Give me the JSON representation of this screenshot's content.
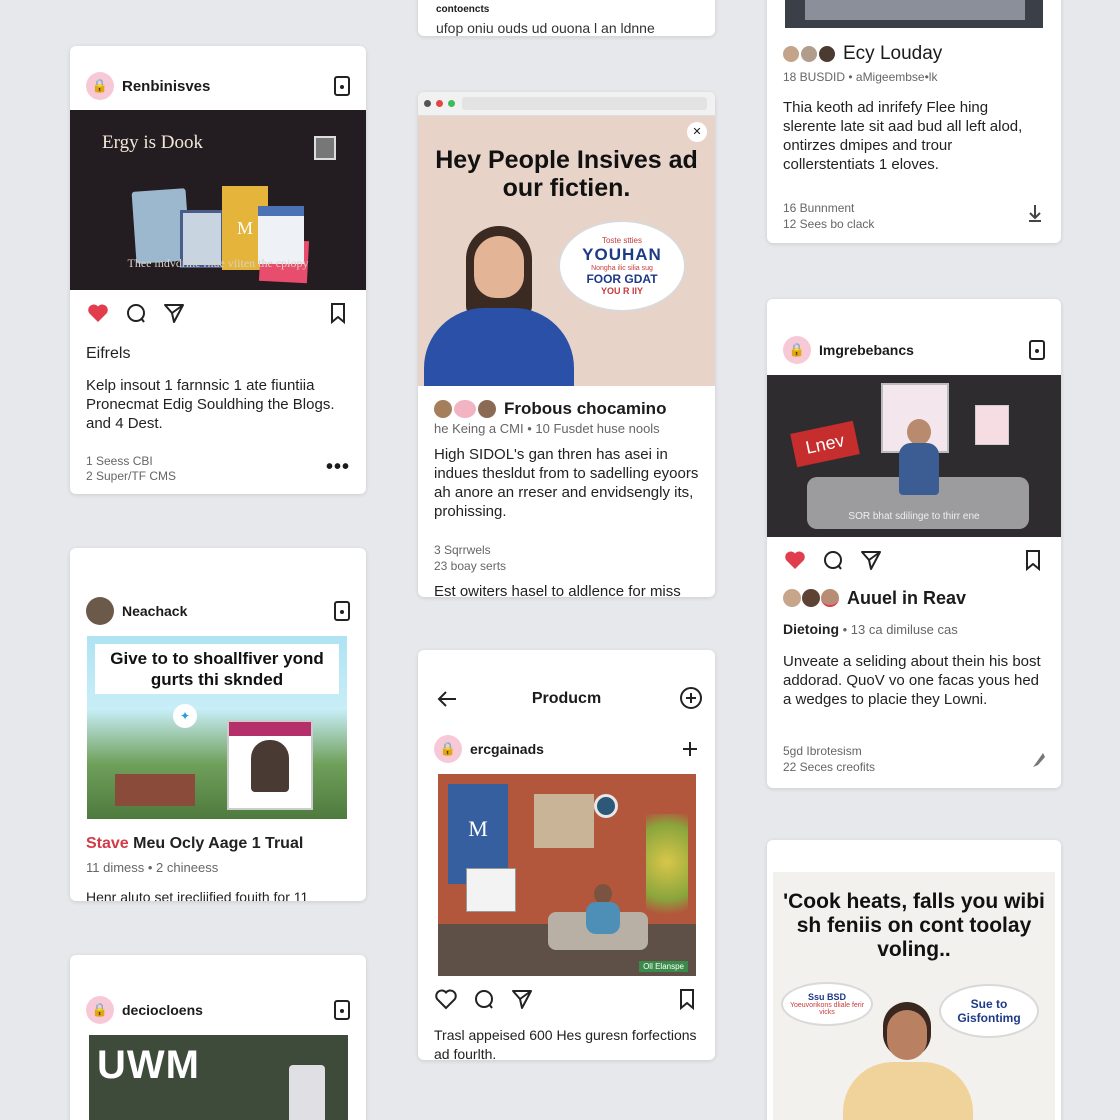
{
  "colors": {
    "like_red": "#e23d4d",
    "page_bg": "#e6e8eb",
    "accent_pink": "#f7c9d7"
  },
  "cards": {
    "top_mid": {
      "line1": "contoencts",
      "line2": "ufop oniu ouds ud ouona l an ldnne"
    },
    "c1": {
      "username": "Renbinisves",
      "image_title": "Ergy is Dook",
      "image_caption": "Thee mdvdrine rnue viiten the cpiopy",
      "book_label": "M",
      "section": "Eifrels",
      "body": "Kelp insout 1 farnnsic 1 ate fiuntiia Pronecmat Edig Souldhing the Blogs. and 4 Dest.",
      "meta1": "1 Seess CBI",
      "meta2": "2 Super/TF CMS",
      "more": "•••"
    },
    "c2": {
      "headline": "Hey People Insives ad our fictien.",
      "bubble_small": "Toste stties",
      "bubble_big": "YOUHAN",
      "bubble_mid": "Nongha ilic silia sug",
      "bubble_line": "FOOR GDAT",
      "bubble_end": "YOU R IIY",
      "username": "Frobous chocamino",
      "subline": "he Keing a CMI • 10 Fusdet huse nools",
      "body": "High SIDOL's gan thren has asei in indues thesldut from to sadelling eyoors ah anore an rreser and envidsengly its, prohissing.",
      "meta1": "3 Sqrrwels",
      "meta2": "23 boay serts",
      "footer": "Est owiters hasel to aldlence for miss"
    },
    "c3": {
      "username": "Ecy Louday",
      "subline": "18 BUSDID • aMigeembse•lk",
      "body": "Thia keoth ad inrifefy Flee hing slerente late sit aad bud all left alod, ontirzes dmipes and trour collerstentiats 1 eloves.",
      "meta1": "16 Bunnment",
      "meta2": "12 Sees bo clack"
    },
    "c4": {
      "username": "Imgrebebancs",
      "sign": "Lnev",
      "image_caption": "SOR bhat sdilinge to thirr ene",
      "names": "Auuel in Reav",
      "sub_bold": "Dietoing",
      "sub_rest": " • 13 ca dimiluse cas",
      "body": "Unveate a seliding about thein his bost addorad. QuoV vo one facas yous hed a wedges to placie they Lowni.",
      "meta1": "5gd Ibrotesism",
      "meta2": "22 Seces creofits"
    },
    "c5": {
      "username": "Neachack",
      "image_headline": "Give to to shoallfiver yond gurts thi sknded",
      "title_red": "Stave",
      "title_rest": " Meu Ocly Aage 1 Trual",
      "subline": "11 dimess • 2 chineess",
      "footer": "Henr aluto set irecliified fouith for 11"
    },
    "c6": {
      "header_title": "Producm",
      "username": "ercgainads",
      "image_tag": "Oll Elanspe",
      "body": "Trasl appeised 600 Hes guresn forfections ad fourlth."
    },
    "c7": {
      "username": "deciocloens",
      "image_text": "UWM"
    },
    "c8": {
      "headline": "'Cook heats, falls you wibi sh feniis on cont toolay voling..",
      "bubble_left": "Ssu BSD",
      "bubble_left_small": "Yoeuvorikons dliale ferir vicks",
      "bubble_right": "Sue to Gisfontimg"
    }
  },
  "icons": [
    "heart-icon",
    "comment-icon",
    "share-icon",
    "bookmark-icon",
    "back-arrow-icon",
    "add-circle-icon",
    "plus-icon",
    "download-arrow-icon"
  ]
}
